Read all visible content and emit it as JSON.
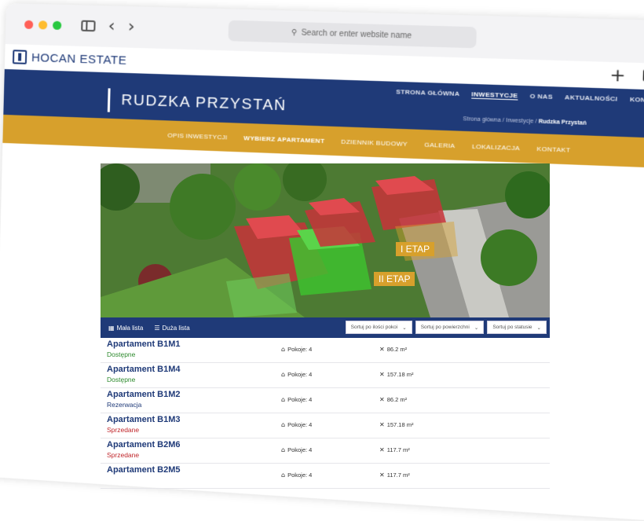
{
  "browser": {
    "url_placeholder": "Search or enter website name",
    "back_glyph": "‹",
    "forward_glyph": "›",
    "plus_glyph": "+"
  },
  "site": {
    "logo_text": "HOCAN ESTATE",
    "topnav": [
      {
        "label": "STRONA GŁÓWNA"
      },
      {
        "label": "INWESTYCJE"
      },
      {
        "label": "O NAS"
      },
      {
        "label": "AKTUALNOŚCI"
      },
      {
        "label": "KONTAKT"
      }
    ],
    "project_title": "RUDZKA PRZYSTAŃ",
    "breadcrumb": {
      "path": "Strona główna / Inwestycje / ",
      "current": "Rudzka Przystań"
    },
    "subnav": [
      {
        "label": "OPIS INWESTYCJI"
      },
      {
        "label": "WYBIERZ APARTAMENT"
      },
      {
        "label": "DZIENNIK BUDOWY"
      },
      {
        "label": "GALERIA"
      },
      {
        "label": "LOKALIZACJA"
      },
      {
        "label": "KONTAKT"
      }
    ]
  },
  "hero": {
    "stage1": "I ETAP",
    "stage2": "II ETAP"
  },
  "listbar": {
    "small_list": "Mała lista",
    "big_list": "Duża lista",
    "sort_rooms": "Sortuj po ilości pokoi",
    "sort_area": "Sortuj po powierzchni",
    "sort_status": "Sortuj po statusie"
  },
  "apartments": [
    {
      "name": "Apartament B1M1",
      "status": "Dostępne",
      "rooms": "Pokoje: 4",
      "area": "86.2  m²"
    },
    {
      "name": "Apartament B1M4",
      "status": "Dostępne",
      "rooms": "Pokoje: 4",
      "area": "157.18  m²"
    },
    {
      "name": "Apartament B1M2",
      "status": "Rezerwacja",
      "rooms": "Pokoje: 4",
      "area": "86.2  m²"
    },
    {
      "name": "Apartament B1M3",
      "status": "Sprzedane",
      "rooms": "Pokoje: 4",
      "area": "157.18  m²"
    },
    {
      "name": "Apartament B2M6",
      "status": "Sprzedane",
      "rooms": "Pokoje: 4",
      "area": "117.7  m²"
    },
    {
      "name": "Apartament B2M5",
      "status": "",
      "rooms": "Pokoje: 4",
      "area": "117.7  m²"
    }
  ],
  "colors": {
    "navy": "#1f3a78",
    "gold": "#d7a02c",
    "available": "#2d8a2d",
    "reserved": "#1f3a78",
    "sold": "#c0262b"
  }
}
